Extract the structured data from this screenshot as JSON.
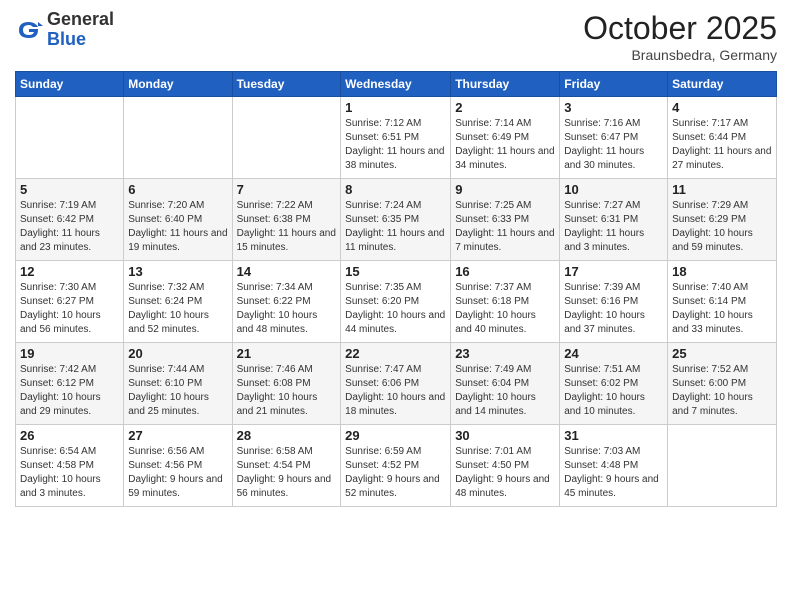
{
  "header": {
    "logo_general": "General",
    "logo_blue": "Blue",
    "month_title": "October 2025",
    "location": "Braunsbedra, Germany"
  },
  "days_of_week": [
    "Sunday",
    "Monday",
    "Tuesday",
    "Wednesday",
    "Thursday",
    "Friday",
    "Saturday"
  ],
  "weeks": [
    [
      {
        "day": "",
        "info": ""
      },
      {
        "day": "",
        "info": ""
      },
      {
        "day": "",
        "info": ""
      },
      {
        "day": "1",
        "info": "Sunrise: 7:12 AM\nSunset: 6:51 PM\nDaylight: 11 hours\nand 38 minutes."
      },
      {
        "day": "2",
        "info": "Sunrise: 7:14 AM\nSunset: 6:49 PM\nDaylight: 11 hours\nand 34 minutes."
      },
      {
        "day": "3",
        "info": "Sunrise: 7:16 AM\nSunset: 6:47 PM\nDaylight: 11 hours\nand 30 minutes."
      },
      {
        "day": "4",
        "info": "Sunrise: 7:17 AM\nSunset: 6:44 PM\nDaylight: 11 hours\nand 27 minutes."
      }
    ],
    [
      {
        "day": "5",
        "info": "Sunrise: 7:19 AM\nSunset: 6:42 PM\nDaylight: 11 hours\nand 23 minutes."
      },
      {
        "day": "6",
        "info": "Sunrise: 7:20 AM\nSunset: 6:40 PM\nDaylight: 11 hours\nand 19 minutes."
      },
      {
        "day": "7",
        "info": "Sunrise: 7:22 AM\nSunset: 6:38 PM\nDaylight: 11 hours\nand 15 minutes."
      },
      {
        "day": "8",
        "info": "Sunrise: 7:24 AM\nSunset: 6:35 PM\nDaylight: 11 hours\nand 11 minutes."
      },
      {
        "day": "9",
        "info": "Sunrise: 7:25 AM\nSunset: 6:33 PM\nDaylight: 11 hours\nand 7 minutes."
      },
      {
        "day": "10",
        "info": "Sunrise: 7:27 AM\nSunset: 6:31 PM\nDaylight: 11 hours\nand 3 minutes."
      },
      {
        "day": "11",
        "info": "Sunrise: 7:29 AM\nSunset: 6:29 PM\nDaylight: 10 hours\nand 59 minutes."
      }
    ],
    [
      {
        "day": "12",
        "info": "Sunrise: 7:30 AM\nSunset: 6:27 PM\nDaylight: 10 hours\nand 56 minutes."
      },
      {
        "day": "13",
        "info": "Sunrise: 7:32 AM\nSunset: 6:24 PM\nDaylight: 10 hours\nand 52 minutes."
      },
      {
        "day": "14",
        "info": "Sunrise: 7:34 AM\nSunset: 6:22 PM\nDaylight: 10 hours\nand 48 minutes."
      },
      {
        "day": "15",
        "info": "Sunrise: 7:35 AM\nSunset: 6:20 PM\nDaylight: 10 hours\nand 44 minutes."
      },
      {
        "day": "16",
        "info": "Sunrise: 7:37 AM\nSunset: 6:18 PM\nDaylight: 10 hours\nand 40 minutes."
      },
      {
        "day": "17",
        "info": "Sunrise: 7:39 AM\nSunset: 6:16 PM\nDaylight: 10 hours\nand 37 minutes."
      },
      {
        "day": "18",
        "info": "Sunrise: 7:40 AM\nSunset: 6:14 PM\nDaylight: 10 hours\nand 33 minutes."
      }
    ],
    [
      {
        "day": "19",
        "info": "Sunrise: 7:42 AM\nSunset: 6:12 PM\nDaylight: 10 hours\nand 29 minutes."
      },
      {
        "day": "20",
        "info": "Sunrise: 7:44 AM\nSunset: 6:10 PM\nDaylight: 10 hours\nand 25 minutes."
      },
      {
        "day": "21",
        "info": "Sunrise: 7:46 AM\nSunset: 6:08 PM\nDaylight: 10 hours\nand 21 minutes."
      },
      {
        "day": "22",
        "info": "Sunrise: 7:47 AM\nSunset: 6:06 PM\nDaylight: 10 hours\nand 18 minutes."
      },
      {
        "day": "23",
        "info": "Sunrise: 7:49 AM\nSunset: 6:04 PM\nDaylight: 10 hours\nand 14 minutes."
      },
      {
        "day": "24",
        "info": "Sunrise: 7:51 AM\nSunset: 6:02 PM\nDaylight: 10 hours\nand 10 minutes."
      },
      {
        "day": "25",
        "info": "Sunrise: 7:52 AM\nSunset: 6:00 PM\nDaylight: 10 hours\nand 7 minutes."
      }
    ],
    [
      {
        "day": "26",
        "info": "Sunrise: 6:54 AM\nSunset: 4:58 PM\nDaylight: 10 hours\nand 3 minutes."
      },
      {
        "day": "27",
        "info": "Sunrise: 6:56 AM\nSunset: 4:56 PM\nDaylight: 9 hours\nand 59 minutes."
      },
      {
        "day": "28",
        "info": "Sunrise: 6:58 AM\nSunset: 4:54 PM\nDaylight: 9 hours\nand 56 minutes."
      },
      {
        "day": "29",
        "info": "Sunrise: 6:59 AM\nSunset: 4:52 PM\nDaylight: 9 hours\nand 52 minutes."
      },
      {
        "day": "30",
        "info": "Sunrise: 7:01 AM\nSunset: 4:50 PM\nDaylight: 9 hours\nand 48 minutes."
      },
      {
        "day": "31",
        "info": "Sunrise: 7:03 AM\nSunset: 4:48 PM\nDaylight: 9 hours\nand 45 minutes."
      },
      {
        "day": "",
        "info": ""
      }
    ]
  ]
}
